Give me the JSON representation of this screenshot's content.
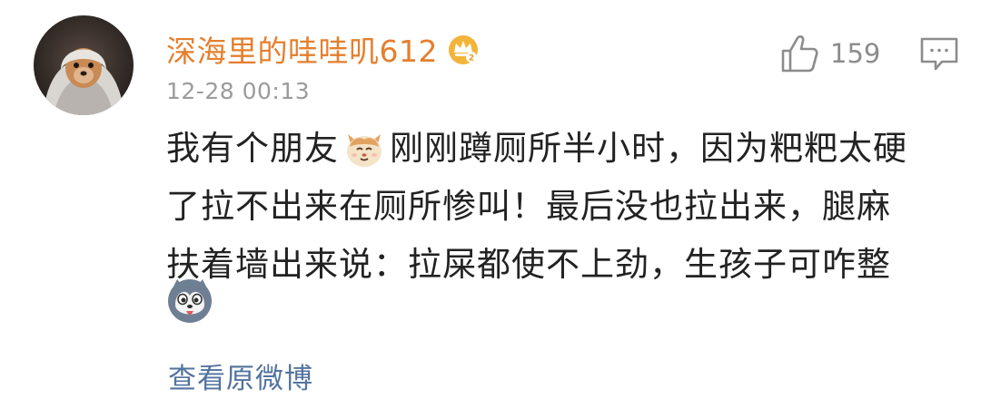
{
  "comment": {
    "username": "深海里的哇哇叽612",
    "timestamp": "12-28 00:13",
    "like_count": "159",
    "text_lines": [
      {
        "before": "我有个朋友",
        "emoji": "cat-face-icon",
        "after": "刚刚蹲厕所半小时，因为粑粑太硬"
      },
      {
        "text": "了拉不出来在厕所惨叫！最后没也拉出来，腿麻"
      },
      {
        "text": "扶着墙出来说：拉屎都使不上劲，生孩子可咋整"
      }
    ],
    "trailing_emoji": "husky-face-icon",
    "view_original_label": "查看原微博"
  },
  "icons": {
    "vip": "crown-icon",
    "like": "thumbs-up-icon",
    "reply": "comment-bubble-icon"
  },
  "colors": {
    "username": "#e57f2d",
    "timestamp": "#9b9b9b",
    "text": "#222222",
    "link": "#52739e",
    "icon_gray": "#8c8c8c"
  }
}
